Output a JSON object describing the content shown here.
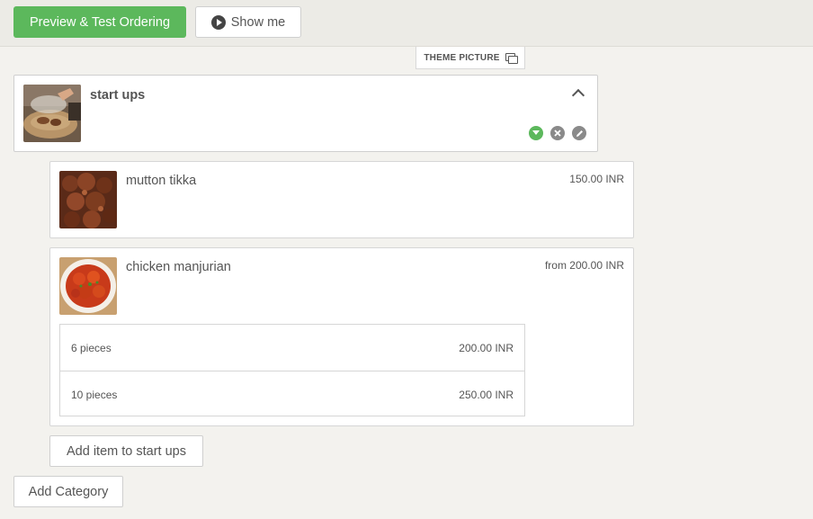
{
  "toolbar": {
    "preview_label": "Preview & Test Ordering",
    "show_me_label": "Show me"
  },
  "theme_picture_label": "THEME PICTURE",
  "category": {
    "title": "start ups",
    "status_color": "#5cb85c"
  },
  "items": [
    {
      "name": "mutton tikka",
      "price": "150.00 INR"
    },
    {
      "name": "chicken manjurian",
      "price": "from 200.00 INR",
      "options": [
        {
          "label": "6 pieces",
          "price": "200.00 INR"
        },
        {
          "label": "10 pieces",
          "price": "250.00 INR"
        }
      ]
    }
  ],
  "add_item_label": "Add item to start ups",
  "add_category_label": "Add Category"
}
